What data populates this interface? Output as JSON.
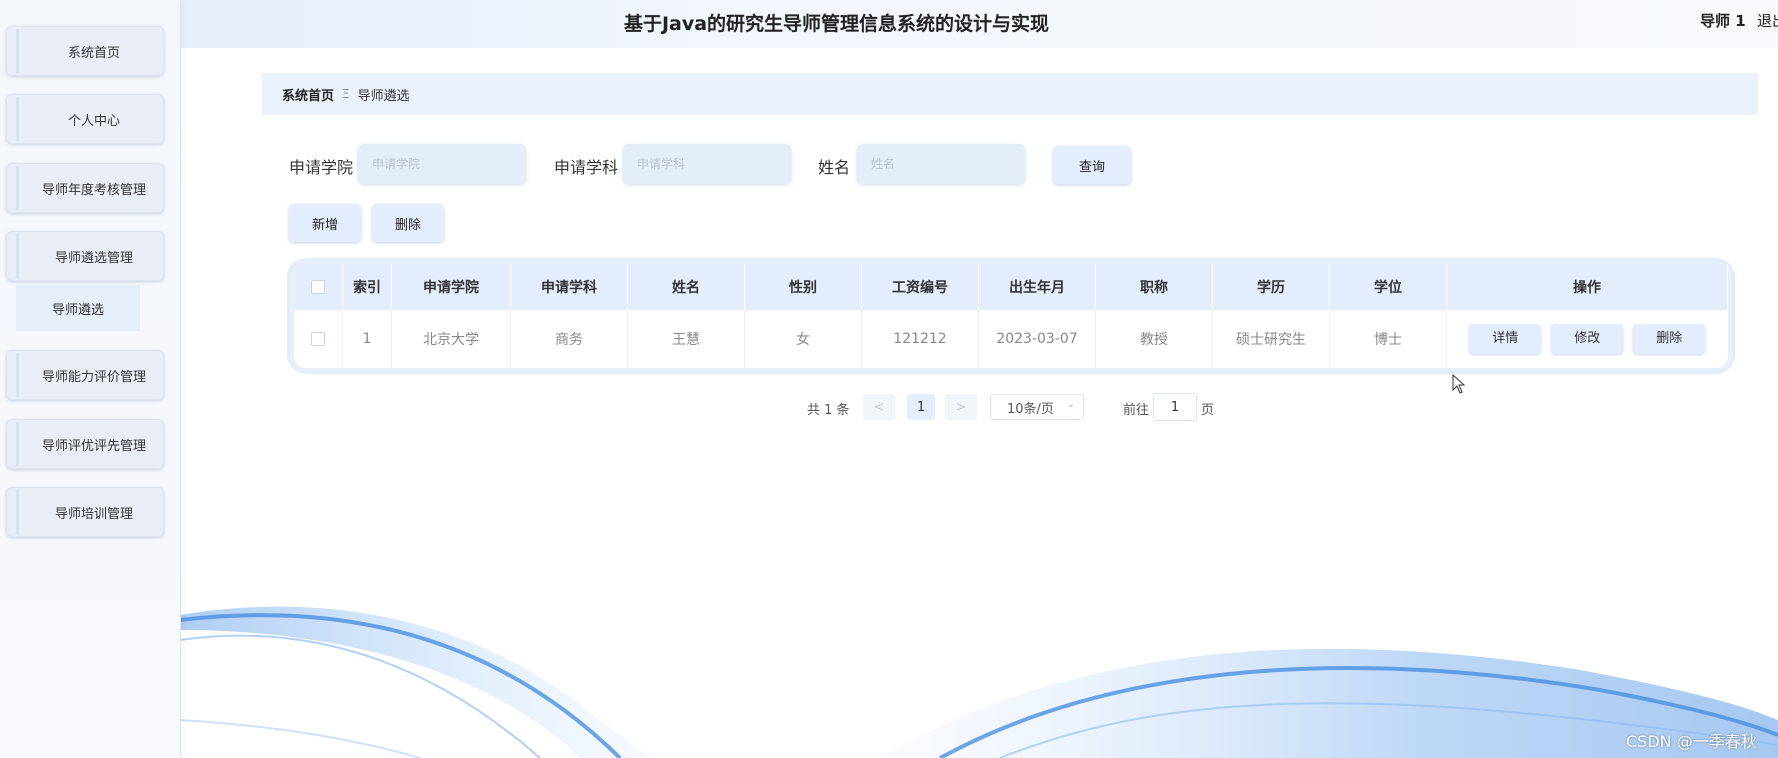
{
  "app": {
    "title": "基于Java的研究生导师管理信息系统的设计与实现",
    "user": "导师 1",
    "logout": "退出"
  },
  "sidebar": {
    "items": [
      {
        "label": "系统首页"
      },
      {
        "label": "个人中心"
      },
      {
        "label": "导师年度考核管理"
      },
      {
        "label": "导师遴选管理"
      },
      {
        "label": "导师能力评价管理"
      },
      {
        "label": "导师评优评先管理"
      },
      {
        "label": "导师培训管理"
      }
    ],
    "submenu": {
      "label": "导师遴选"
    }
  },
  "breadcrumb": {
    "home": "系统首页",
    "separator": "Ξ",
    "current": "导师遴选"
  },
  "search": {
    "college_label": "申请学院",
    "college_placeholder": "申请学院",
    "subject_label": "申请学科",
    "subject_placeholder": "申请学科",
    "name_label": "姓名",
    "name_placeholder": "姓名",
    "query_button": "查询"
  },
  "actions": {
    "add": "新增",
    "delete": "删除"
  },
  "table": {
    "headers": [
      "索引",
      "申请学院",
      "申请学科",
      "姓名",
      "性别",
      "工资编号",
      "出生年月",
      "职称",
      "学历",
      "学位",
      "操作"
    ],
    "rows": [
      {
        "index": "1",
        "college": "北京大学",
        "subject": "商务",
        "name": "王慧",
        "gender": "女",
        "salary_no": "121212",
        "birth": "2023-03-07",
        "title": "教授",
        "education": "硕士研究生",
        "degree": "博士",
        "ops": [
          "详情",
          "修改",
          "删除"
        ]
      }
    ]
  },
  "pagination": {
    "total": "共 1 条",
    "prev": "<",
    "page": "1",
    "next": ">",
    "page_size": "10条/页",
    "goto_label": "前往",
    "goto_value": "1",
    "goto_suffix": "页"
  },
  "watermark": "CSDN @一季春秋",
  "colors": {
    "accent": "#e3edfb",
    "sidebar_bg": "#f4f7fc",
    "wave": "#4a90e2"
  }
}
